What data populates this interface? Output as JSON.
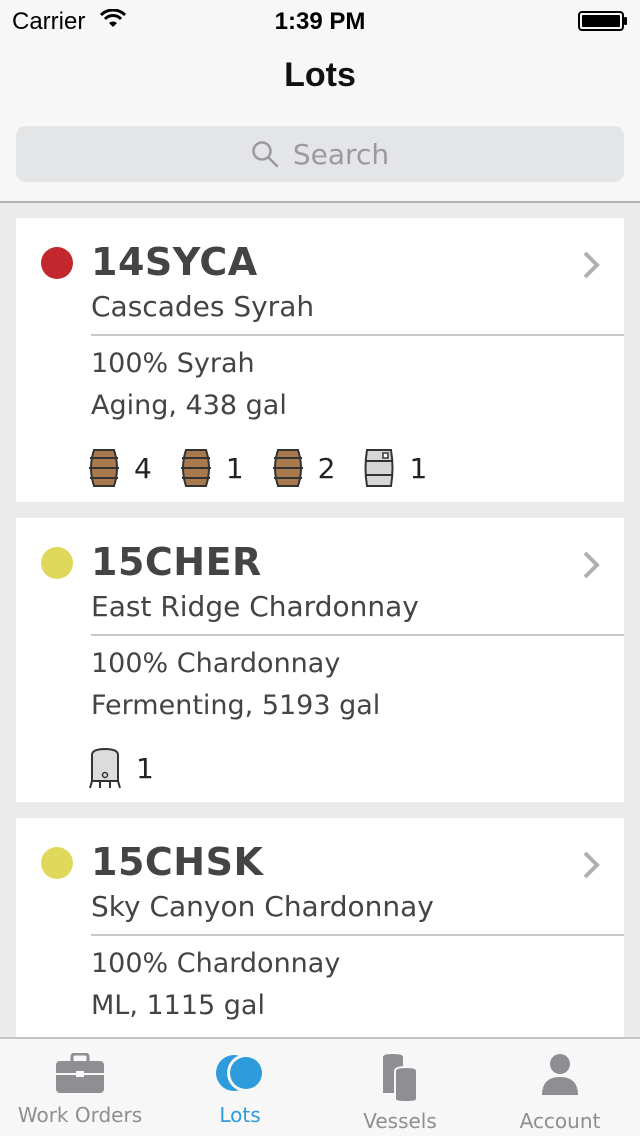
{
  "status_bar": {
    "carrier": "Carrier",
    "time": "1:39 PM"
  },
  "nav": {
    "title": "Lots"
  },
  "search": {
    "placeholder": "Search"
  },
  "lots": [
    {
      "code": "14SYCA",
      "name": "Cascades Syrah",
      "composition": "100% Syrah",
      "status": "Aging, 438 gal",
      "dot_color": "#c1272d",
      "vessels": [
        {
          "icon": "barrel-icon",
          "count": "4"
        },
        {
          "icon": "barrel-icon",
          "count": "1"
        },
        {
          "icon": "barrel-icon",
          "count": "2"
        },
        {
          "icon": "keg-icon",
          "count": "1"
        }
      ]
    },
    {
      "code": "15CHER",
      "name": "East Ridge Chardonnay",
      "composition": "100% Chardonnay",
      "status": "Fermenting, 5193 gal",
      "dot_color": "#e0d85a",
      "vessels": [
        {
          "icon": "tank-icon",
          "count": "1"
        }
      ]
    },
    {
      "code": "15CHSK",
      "name": "Sky Canyon Chardonnay",
      "composition": "100% Chardonnay",
      "status": "ML, 1115 gal",
      "dot_color": "#e0d85a",
      "vessels": []
    }
  ],
  "tabs": [
    {
      "label": "Work Orders",
      "icon": "briefcase-icon",
      "active": false
    },
    {
      "label": "Lots",
      "icon": "lots-icon",
      "active": true
    },
    {
      "label": "Vessels",
      "icon": "vessels-icon",
      "active": false
    },
    {
      "label": "Account",
      "icon": "person-icon",
      "active": false
    }
  ],
  "colors": {
    "accent": "#2e9bdc",
    "barrel": "#a8784e",
    "inactive_tab": "#8e8e93"
  }
}
